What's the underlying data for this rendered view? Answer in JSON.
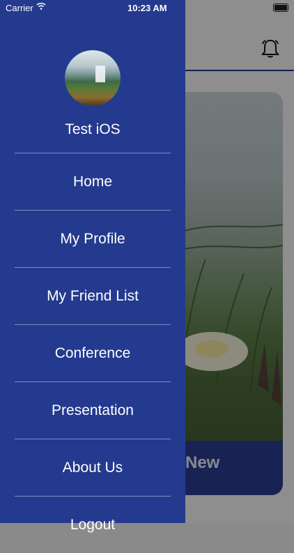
{
  "status_bar": {
    "carrier": "Carrier",
    "time": "10:23 AM"
  },
  "drawer": {
    "username": "Test iOS",
    "items": [
      {
        "label": "Home"
      },
      {
        "label": "My Profile"
      },
      {
        "label": "My Friend List"
      },
      {
        "label": "Conference"
      },
      {
        "label": "Presentation"
      },
      {
        "label": "About Us"
      },
      {
        "label": "Logout"
      }
    ]
  },
  "background_app": {
    "card_footer_text": "New",
    "header_icon": "bell-icon"
  },
  "colors": {
    "drawer_bg": "#243a8e",
    "accent": "#223a8a",
    "text": "#ffffff"
  }
}
